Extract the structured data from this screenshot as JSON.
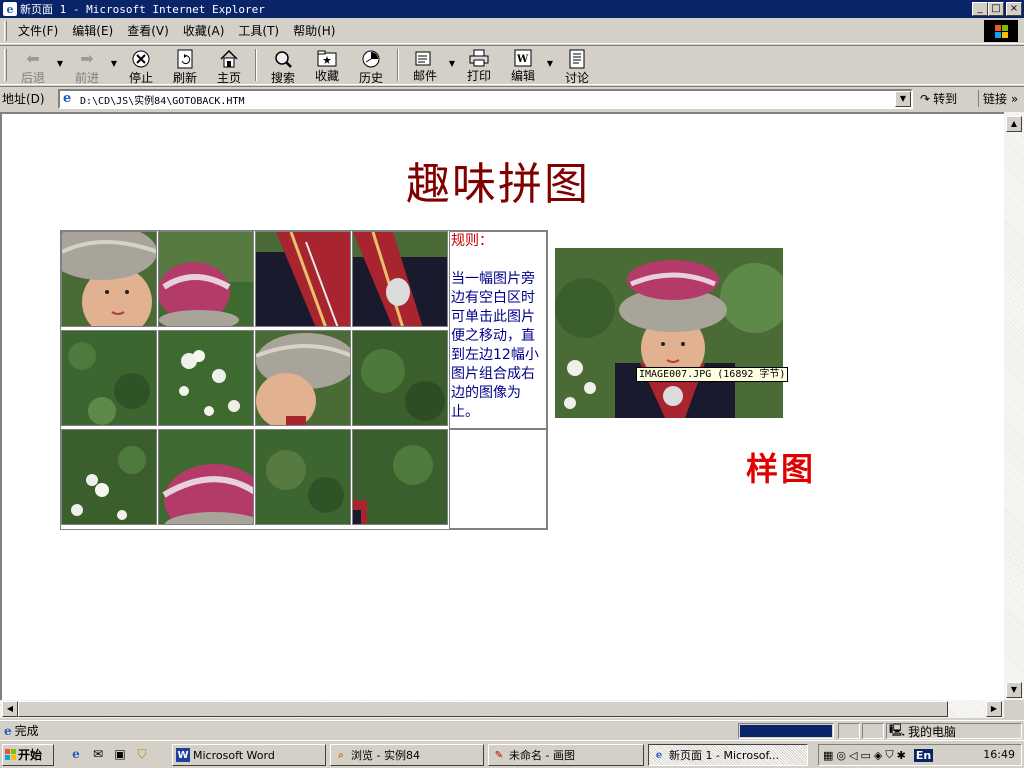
{
  "window": {
    "title": "新页面 1 - Microsoft Internet Explorer",
    "min": "_",
    "max": "□",
    "close": "×"
  },
  "menu": {
    "items": [
      "文件(F)",
      "编辑(E)",
      "查看(V)",
      "收藏(A)",
      "工具(T)",
      "帮助(H)"
    ]
  },
  "toolbar": {
    "back": "后退",
    "forward": "前进",
    "stop": "停止",
    "refresh": "刷新",
    "home": "主页",
    "search": "搜索",
    "favorites": "收藏",
    "history": "历史",
    "mail": "邮件",
    "print": "打印",
    "edit": "编辑",
    "discuss": "讨论"
  },
  "address": {
    "label": "地址(D)",
    "url": "D:\\CD\\JS\\实例84\\GOTOBACK.HTM",
    "go": "转到",
    "links": "链接 »"
  },
  "page": {
    "title": "趣味拼图",
    "rules_head": "规则：",
    "rules_body": "当一幅图片旁边有空白区时可单击此图片便之移动，直到左边12幅小图片组合成右边的图像为止。",
    "tooltip": "IMAGE007.JPG (16892 字节)",
    "sample_label": "样图"
  },
  "status": {
    "text": "完成",
    "zone": "我的电脑"
  },
  "taskbar": {
    "start": "开始",
    "tasks": [
      "Microsoft Word",
      "浏览 - 实例84",
      "未命名 - 画图",
      "新页面 1 - Microsof..."
    ],
    "ime": "En",
    "clock": "16:49"
  },
  "colors": {
    "title_red": "#800000",
    "rules_blue": "#00008b",
    "rules_red": "#cc0000",
    "sample_red": "#e00000"
  }
}
